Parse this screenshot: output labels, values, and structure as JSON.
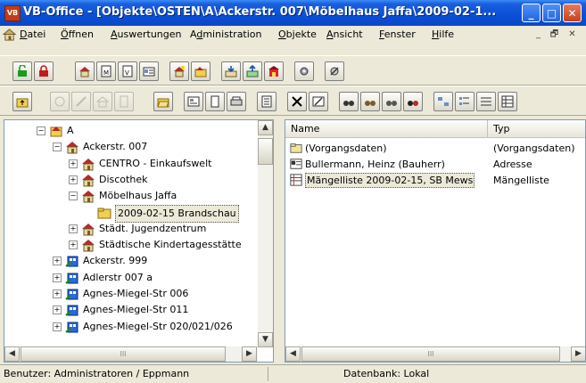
{
  "window": {
    "title": "VB-Office - [Objekte\\OSTEN\\A\\Ackerstr. 007\\Möbelhaus Jaffa\\2009-02-1...",
    "app_badge": "VB",
    "minimize": "_",
    "maximize": "□",
    "close": "✕"
  },
  "menu": {
    "items": [
      "Datei",
      "Öffnen",
      "Auswertungen",
      "Administration",
      "Objekte",
      "Ansicht",
      "Fenster",
      "Hilfe"
    ],
    "accel": [
      "D",
      "Ö",
      "A",
      "d",
      "O",
      "A",
      "F",
      "H"
    ],
    "mdi_min": "_",
    "mdi_restore": "🗗",
    "mdi_close": "✕"
  },
  "tree": {
    "rows": [
      {
        "label": "A",
        "expander": "−"
      },
      {
        "label": "Ackerstr. 007",
        "expander": "−"
      },
      {
        "label": "CENTRO - Einkaufswelt",
        "expander": "+"
      },
      {
        "label": "Discothek",
        "expander": "+"
      },
      {
        "label": "Möbelhaus Jaffa",
        "expander": "−"
      },
      {
        "label": "2009-02-15 Brandschau",
        "expander": ""
      },
      {
        "label": "Städt. Jugendzentrum",
        "expander": "+"
      },
      {
        "label": "Städtische Kindertagesstätte",
        "expander": "+"
      },
      {
        "label": "Ackerstr. 999",
        "expander": "+"
      },
      {
        "label": "Adlerstr 007 a",
        "expander": "+"
      },
      {
        "label": "Agnes-Miegel-Str 006",
        "expander": "+"
      },
      {
        "label": "Agnes-Miegel-Str 011",
        "expander": "+"
      },
      {
        "label": "Agnes-Miegel-Str 020/021/026",
        "expander": "+"
      }
    ],
    "scroll_up": "▲",
    "scroll_down": "▼",
    "scroll_left": "◀",
    "scroll_right": "▶",
    "grip": "III"
  },
  "list": {
    "columns": [
      "Name",
      "Typ"
    ],
    "rows": [
      {
        "name": "(Vorgangsdaten)",
        "type": "(Vorgangsdaten)"
      },
      {
        "name": "Bullermann, Heinz (Bauherr)",
        "type": "Adresse"
      },
      {
        "name": "Mängelliste 2009-02-15, SB Mews",
        "type": "Mängelliste"
      }
    ],
    "scroll_left": "◀",
    "scroll_right": "▶",
    "grip": "III"
  },
  "status": {
    "user": "Benutzer: Administratoren / Eppmann",
    "database": "Datenbank: Lokal"
  },
  "colors": {
    "titlebar": "#0a4fd6",
    "face": "#ece9d8",
    "pane_border": "#7f9db9"
  }
}
